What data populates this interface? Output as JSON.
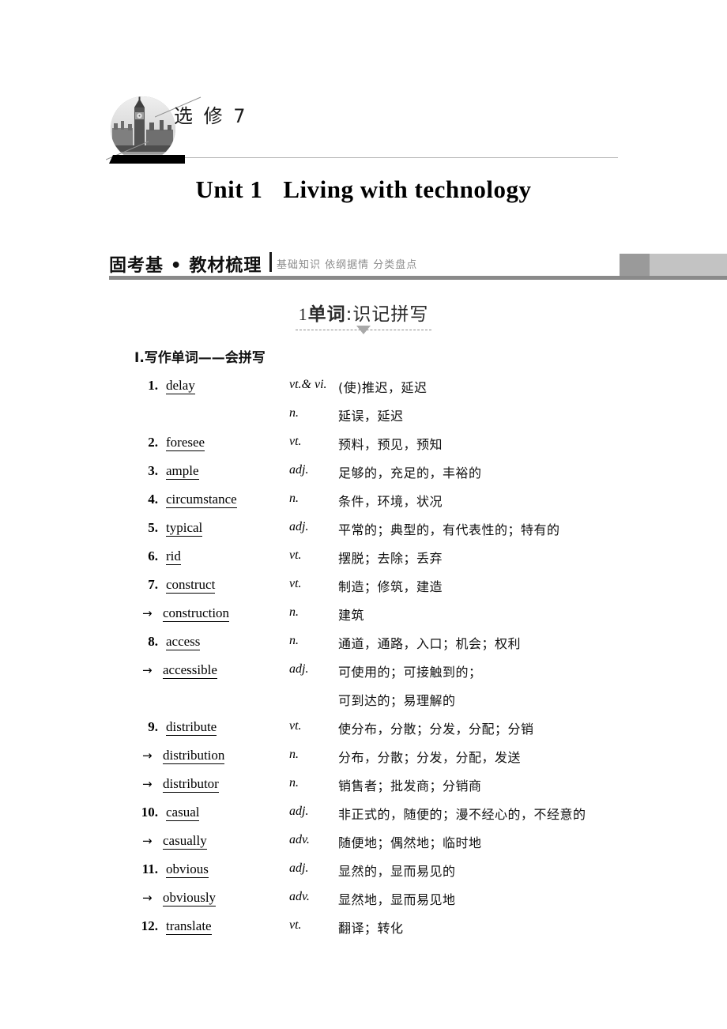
{
  "masthead": {
    "edition_label": "选 修 7",
    "photo_icon": "big-ben-westminster-photo"
  },
  "unit": {
    "number_label": "Unit 1",
    "title_label": "Living with technology"
  },
  "band": {
    "main_label": "固考基 • 教材梳理",
    "sub_label": "基础知识 依纲据情 分类盘点",
    "block1_color": "#9a9a9a",
    "block2_color": "#c3c3c3",
    "underline_color": "#8a8a8a"
  },
  "subsection": {
    "number": "1",
    "title_bold": "单词",
    "title_rest": ":识记拼写"
  },
  "list": {
    "heading": "Ⅰ.写作单词——会拼写",
    "rows": [
      {
        "num": "1.",
        "word": "delay",
        "pos": "vt.& vi.",
        "meaning": "(使)推迟，延迟",
        "type": "main"
      },
      {
        "num": "",
        "word": "",
        "pos": "n.",
        "meaning": "延误，延迟",
        "type": "cont"
      },
      {
        "num": "2.",
        "word": "foresee",
        "pos": "vt.",
        "meaning": "预料，预见，预知",
        "type": "main"
      },
      {
        "num": "3.",
        "word": "ample",
        "pos": "adj.",
        "meaning": "足够的，充足的，丰裕的",
        "type": "main"
      },
      {
        "num": "4.",
        "word": "circumstance",
        "pos": "n.",
        "meaning": "条件，环境，状况",
        "type": "main"
      },
      {
        "num": "5.",
        "word": "typical",
        "pos": "adj.",
        "meaning": "平常的；典型的，有代表性的；特有的",
        "type": "main"
      },
      {
        "num": "6.",
        "word": "rid",
        "pos": "vt.",
        "meaning": "摆脱；去除；丢弃",
        "type": "main"
      },
      {
        "num": "7.",
        "word": "construct",
        "pos": "vt.",
        "meaning": "制造；修筑，建造",
        "type": "main"
      },
      {
        "num": "→",
        "word": "construction",
        "pos": "n.",
        "meaning": "建筑",
        "type": "derived"
      },
      {
        "num": "8.",
        "word": "access",
        "pos": "n.",
        "meaning": "通道，通路，入口；机会；权利",
        "type": "main"
      },
      {
        "num": "→",
        "word": "accessible",
        "pos": "adj.",
        "meaning": "可使用的；可接触到的；",
        "type": "derived"
      },
      {
        "num": "",
        "word": "",
        "pos": "",
        "meaning": "可到达的；易理解的",
        "type": "cont"
      },
      {
        "num": "9.",
        "word": "distribute",
        "pos": "vt.",
        "meaning": "使分布，分散；分发，分配；分销",
        "type": "main"
      },
      {
        "num": "→",
        "word": "distribution",
        "pos": "n.",
        "meaning": "分布，分散；分发，分配，发送",
        "type": "derived"
      },
      {
        "num": "→",
        "word": "distributor",
        "pos": "n.",
        "meaning": "销售者；批发商；分销商",
        "type": "derived"
      },
      {
        "num": "10.",
        "word": "casual",
        "pos": "adj.",
        "meaning": "非正式的，随便的；漫不经心的，不经意的",
        "type": "main"
      },
      {
        "num": "→",
        "word": "casually",
        "pos": "adv.",
        "meaning": "随便地；偶然地；临时地",
        "type": "derived"
      },
      {
        "num": "11.",
        "word": "obvious",
        "pos": "adj.",
        "meaning": "显然的，显而易见的",
        "type": "main"
      },
      {
        "num": "→",
        "word": "obviously",
        "pos": "adv.",
        "meaning": "显然地，显而易见地",
        "type": "derived"
      },
      {
        "num": "12.",
        "word": "translate",
        "pos": "vt.",
        "meaning": "翻译；转化",
        "type": "main"
      }
    ]
  }
}
